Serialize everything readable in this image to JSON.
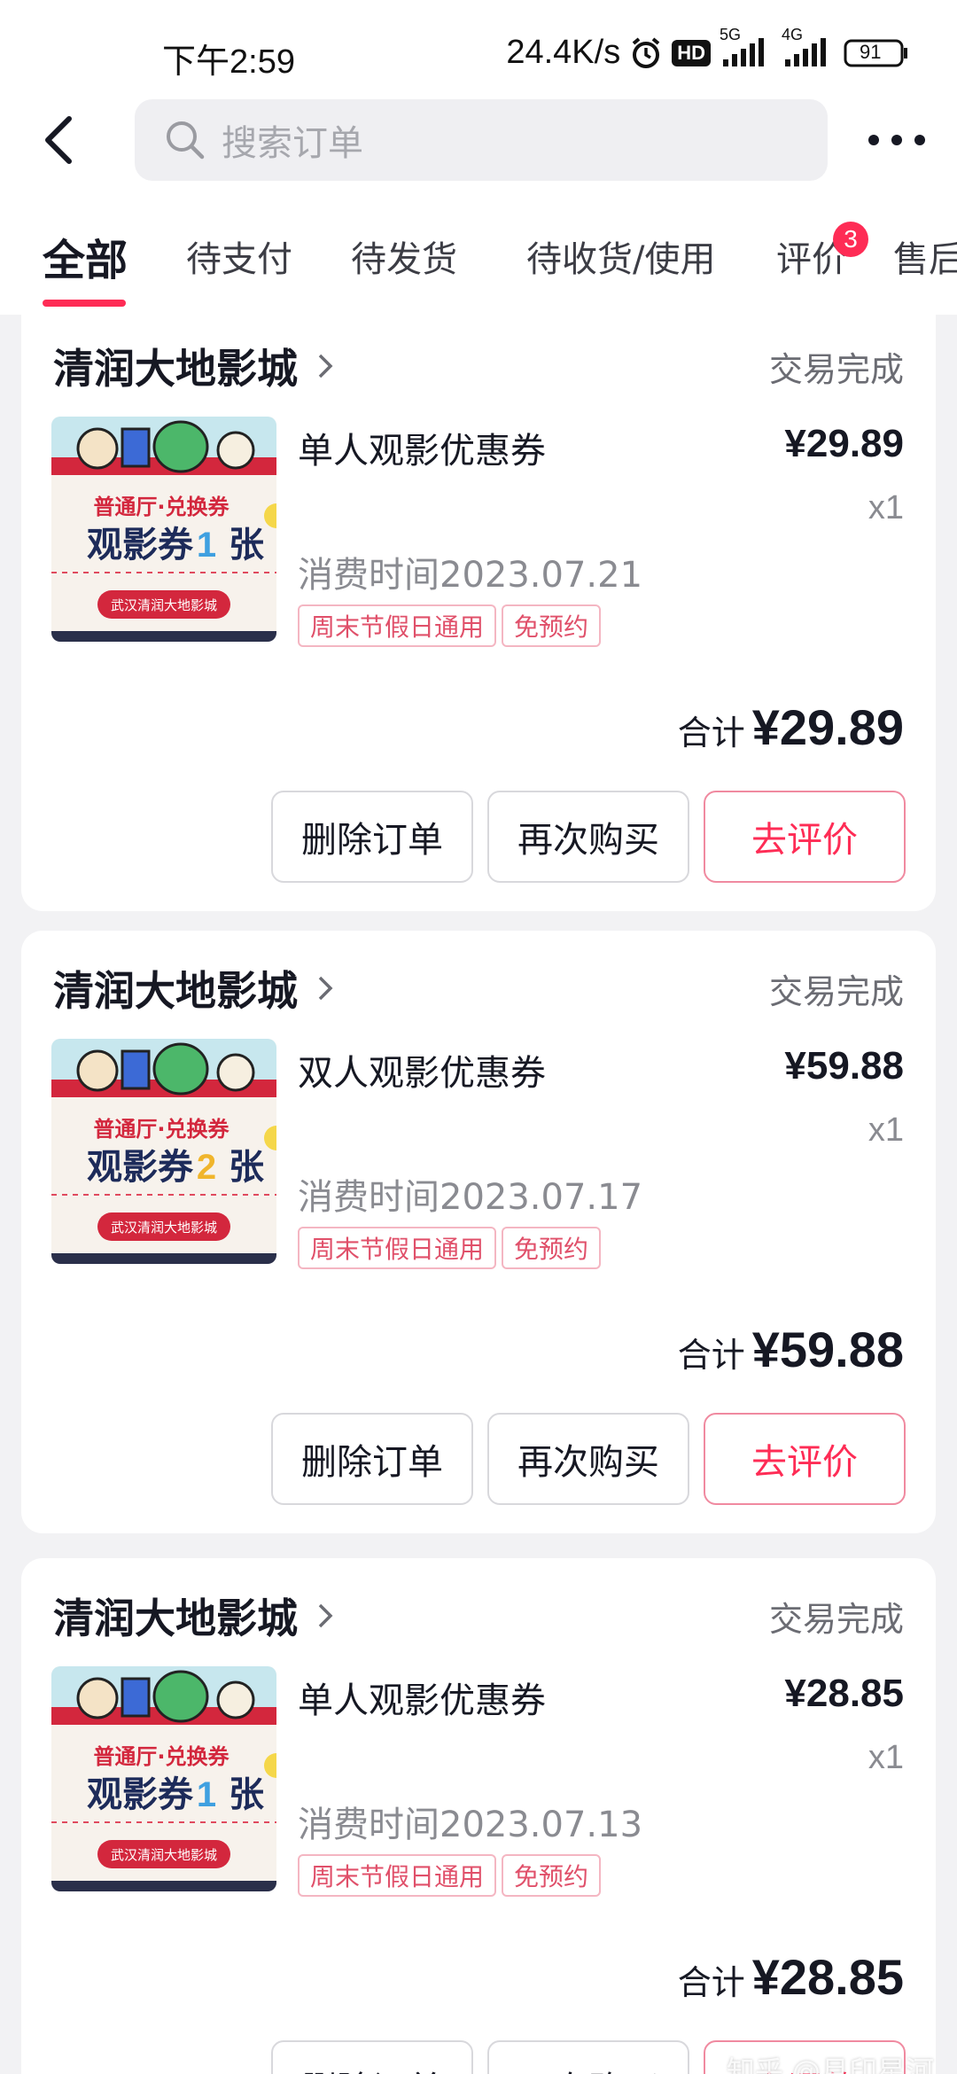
{
  "status": {
    "time": "下午2:59",
    "speed": "24.4K/s",
    "hd": "HD",
    "net1": "5G",
    "net2": "4G",
    "battery": "91"
  },
  "search": {
    "placeholder": "搜索订单"
  },
  "tabs": [
    {
      "label": "全部"
    },
    {
      "label": "待支付"
    },
    {
      "label": "待发货"
    },
    {
      "label": "待收货/使用"
    },
    {
      "label": "评价",
      "badge": "3"
    },
    {
      "label": "售后"
    }
  ],
  "orders": [
    {
      "shop": "清润大地影城",
      "state": "交易完成",
      "product": "单人观影优惠券",
      "price": "¥29.89",
      "qty": "x1",
      "time": "消费时间2023.07.21",
      "tags": [
        "周末节假日通用",
        "免预约"
      ],
      "total_label": "合计",
      "total": "¥29.89",
      "thumb": {
        "line1": "普通厅·兑换券",
        "line2a": "观影券",
        "num": "1",
        "line2b": "张",
        "cinema": "武汉清润大地影城"
      },
      "buttons": [
        "删除订单",
        "再次购买",
        "去评价"
      ]
    },
    {
      "shop": "清润大地影城",
      "state": "交易完成",
      "product": "双人观影优惠券",
      "price": "¥59.88",
      "qty": "x1",
      "time": "消费时间2023.07.17",
      "tags": [
        "周末节假日通用",
        "免预约"
      ],
      "total_label": "合计",
      "total": "¥59.88",
      "thumb": {
        "line1": "普通厅·兑换券",
        "line2a": "观影券",
        "num": "2",
        "line2b": "张",
        "cinema": "武汉清润大地影城"
      },
      "buttons": [
        "删除订单",
        "再次购买",
        "去评价"
      ]
    },
    {
      "shop": "清润大地影城",
      "state": "交易完成",
      "product": "单人观影优惠券",
      "price": "¥28.85",
      "qty": "x1",
      "time": "消费时间2023.07.13",
      "tags": [
        "周末节假日通用",
        "免预约"
      ],
      "total_label": "合计",
      "total": "¥28.85",
      "thumb": {
        "line1": "普通厅·兑换券",
        "line2a": "观影券",
        "num": "1",
        "line2b": "张",
        "cinema": "武汉清润大地影城"
      },
      "buttons": [
        "删除订单",
        "再次购买",
        "去评价"
      ]
    }
  ],
  "watermark": "知乎 @月印星河",
  "colors": {
    "accent": "#fe2c55",
    "text": "#161823",
    "muted": "#8a8b91",
    "background": "#f2f2f4"
  }
}
